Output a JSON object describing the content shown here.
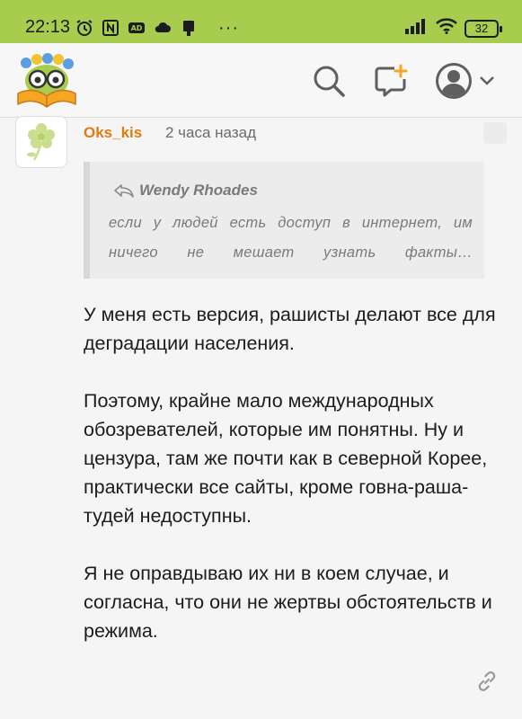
{
  "status_bar": {
    "time": "22:13",
    "battery": "32",
    "overflow": "···"
  },
  "header": {
    "logo_icon": "book-owl-logo-icon",
    "search_icon": "search-icon",
    "new_message_icon": "new-message-icon",
    "avatar_icon": "user-avatar-icon",
    "dropdown_icon": "chevron-down-icon"
  },
  "comment": {
    "author": "Oks_kis",
    "time_ago": "2 часа назад",
    "quote": {
      "author": "Wendy Rhoades",
      "line1": "если у людей есть доступ в интернет, им",
      "line2": "ничего не мешает узнать факты…"
    },
    "paragraphs": [
      "У меня есть версия, рашисты делают все для деградации населения.",
      "Поэтому, крайне мало международных обозревателей, которые им понятны. Ну и цензура, там же почти как в северной Корее, практически все сайты, кроме говна-раша-тудей недоступны.",
      "Я не оправдываю их ни в коем случае, и согласна, что они не жертвы обстоятельств и режима."
    ]
  },
  "colors": {
    "status_bar": "#a8cd4e",
    "author": "#e07b10",
    "accent_orange": "#f5a623"
  }
}
